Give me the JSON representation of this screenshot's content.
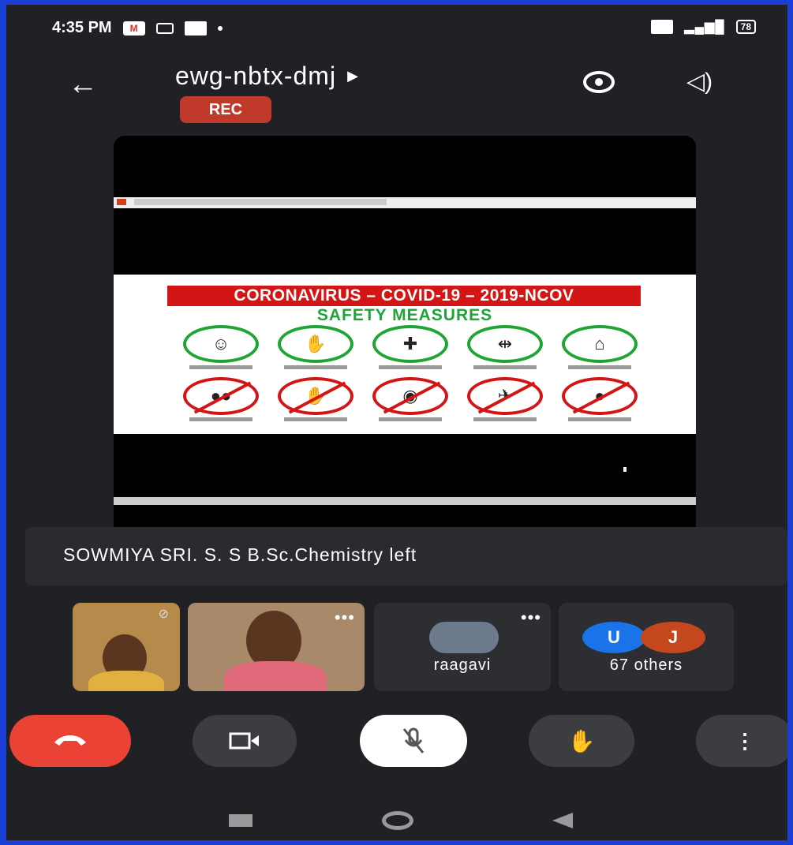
{
  "status_bar": {
    "time": "4:35 PM",
    "battery": "78"
  },
  "meeting": {
    "code": "ewg-nbtx-dmj",
    "rec_label": "REC"
  },
  "slide": {
    "banner": "CORONAVIRUS – COVID-19 – 2019-NCOV",
    "subtitle": "SAFETY MEASURES"
  },
  "notification": "SOWMIYA SRI. S. S B.Sc.Chemistry left",
  "participants": [
    {
      "name": "raagavi"
    },
    {
      "name": "67 others",
      "avatars": [
        {
          "letter": "U",
          "color": "#1a73e8"
        },
        {
          "letter": "J",
          "color": "#c5471d"
        }
      ]
    }
  ],
  "controls": [
    "end-call",
    "camera",
    "microphone",
    "raise-hand",
    "more-options"
  ]
}
